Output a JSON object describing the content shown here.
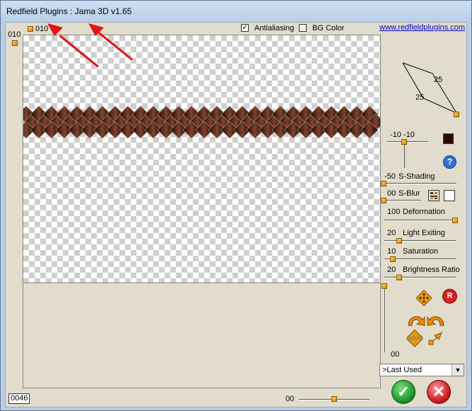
{
  "window": {
    "title": "Redfield Plugins : Jama 3D   v1.65"
  },
  "top": {
    "offset_top_label": "010",
    "offset_left_label": "010",
    "antialiasing_label": "Antialiasing",
    "antialiasing_checked": true,
    "bgcolor_label": "BG Color",
    "bgcolor_checked": false,
    "website": "www.redfieldplugins.com"
  },
  "angles": {
    "a": "25",
    "b": "25"
  },
  "light": {
    "x": "-10",
    "y": "-10",
    "color": "#2b0a05"
  },
  "help_icon": "question-icon",
  "sliders": [
    {
      "id": "s-shading",
      "value": "-50",
      "label": "S-Shading"
    },
    {
      "id": "s-blur",
      "value": "00",
      "label": "S-Blur"
    },
    {
      "id": "deformation",
      "value": "100",
      "label": "Deformation"
    },
    {
      "id": "light-exiting",
      "value": "20",
      "label": "Light Exiting"
    },
    {
      "id": "saturation",
      "value": "10",
      "label": "Saturation"
    },
    {
      "id": "brightness-ratio",
      "value": "20",
      "label": "Brightness Ratio"
    }
  ],
  "vertical_slider_value": "00",
  "zoom_value": "0046",
  "bottom_slider_value": "00",
  "preset": ">Last Used",
  "ok_icon": "check-icon",
  "cancel_icon": "cross-icon",
  "colors": {
    "accent_orange": "#e59a14",
    "ok_green": "#1f9a2e",
    "cancel_red": "#d21f24",
    "shadow_swatch": "#ffffff"
  }
}
